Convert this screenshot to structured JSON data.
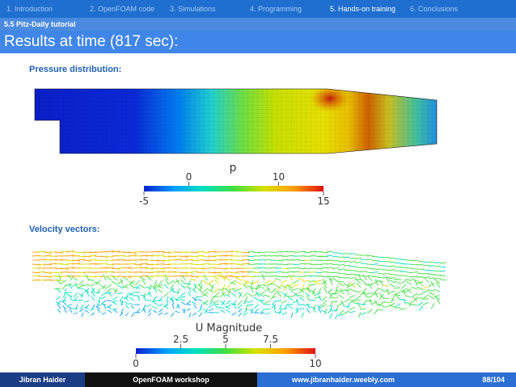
{
  "nav": {
    "items": [
      {
        "label": "1. Introduction"
      },
      {
        "label": "2. OpenFOAM code"
      },
      {
        "label": "3. Simulations"
      },
      {
        "label": "4. Programming"
      },
      {
        "label": "5. Hands-on training"
      },
      {
        "label": "6. Conclusions"
      }
    ],
    "active_index": 4
  },
  "subsection": "5.5 Pitz-Daily tutorial",
  "title": "Results at time (817 sec):",
  "pressure": {
    "label": "Pressure distribution:",
    "legend": {
      "title": "p",
      "min": -5,
      "max": 15,
      "ticks": [
        {
          "value": 0,
          "text": "0",
          "pos": "top"
        },
        {
          "value": 10,
          "text": "10",
          "pos": "top"
        },
        {
          "value": -5,
          "text": "-5",
          "pos": "bottom"
        },
        {
          "value": 15,
          "text": "15",
          "pos": "bottom"
        }
      ]
    }
  },
  "velocity": {
    "label": "Velocity vectors:",
    "legend": {
      "title": "U Magnitude",
      "min": 0,
      "max": 10,
      "ticks": [
        {
          "value": 2.5,
          "text": "2.5",
          "pos": "top"
        },
        {
          "value": 5,
          "text": "5",
          "pos": "top"
        },
        {
          "value": 7.5,
          "text": "7.5",
          "pos": "top"
        },
        {
          "value": 0,
          "text": "0",
          "pos": "bottom"
        },
        {
          "value": 10,
          "text": "10",
          "pos": "bottom"
        }
      ]
    }
  },
  "colormap": [
    "#0a20d0",
    "#00a0ff",
    "#00e0c0",
    "#40e040",
    "#d8e000",
    "#ffa000",
    "#e01010"
  ],
  "footer": {
    "author": "Jibran Haider",
    "event": "OpenFOAM workshop",
    "website": "www.jibranhaider.weebly.com",
    "page": "88/104"
  }
}
